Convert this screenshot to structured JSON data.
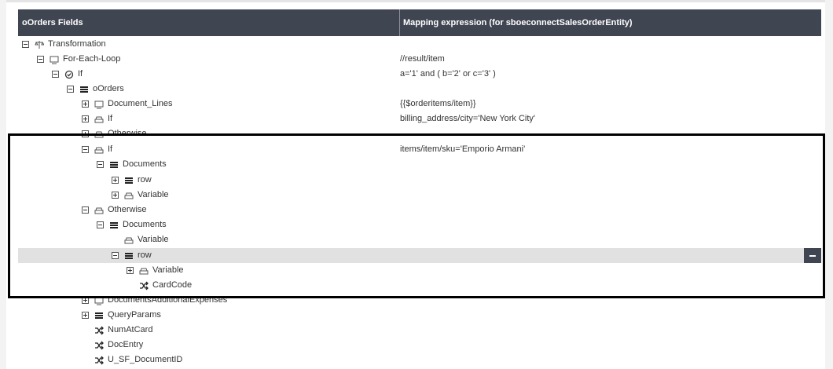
{
  "header": {
    "col_fields": "oOrders Fields",
    "col_mapping": "Mapping expression (for sboeconnectSalesOrderEntity)"
  },
  "rows": [
    {
      "label": "Transformation",
      "mapping": ""
    },
    {
      "label": "For-Each-Loop",
      "mapping": "//result/item"
    },
    {
      "label": "If",
      "mapping": "a='1' and ( b='2' or c='3' )"
    },
    {
      "label": "oOrders",
      "mapping": ""
    },
    {
      "label": "Document_Lines",
      "mapping": "{{$orderitems/item}}"
    },
    {
      "label": "If",
      "mapping": "billing_address/city='New York City'"
    },
    {
      "label": "Otherwise",
      "mapping": ""
    },
    {
      "label": "If",
      "mapping": "items/item/sku='Emporio Armani'"
    },
    {
      "label": "Documents",
      "mapping": ""
    },
    {
      "label": "row",
      "mapping": ""
    },
    {
      "label": "Variable",
      "mapping": ""
    },
    {
      "label": "Otherwise",
      "mapping": ""
    },
    {
      "label": "Documents",
      "mapping": ""
    },
    {
      "label": "Variable",
      "mapping": ""
    },
    {
      "label": "row",
      "mapping": ""
    },
    {
      "label": "Variable",
      "mapping": ""
    },
    {
      "label": "CardCode",
      "mapping": ""
    },
    {
      "label": "DocumentsAdditionalExpenses",
      "mapping": ""
    },
    {
      "label": "QueryParams",
      "mapping": ""
    },
    {
      "label": "NumAtCard",
      "mapping": ""
    },
    {
      "label": "DocEntry",
      "mapping": ""
    },
    {
      "label": "U_SF_DocumentID",
      "mapping": ""
    }
  ],
  "icons": {
    "transformation": "transformation-icon",
    "loop": "loop-icon",
    "if_check": "check-circle-icon",
    "list": "list-icon",
    "condition": "condition-icon",
    "mapping": "shuffle-icon"
  },
  "colors": {
    "header_bg": "#3f4551",
    "selected_row": "#e1e1e1",
    "highlight_border": "#000000"
  }
}
